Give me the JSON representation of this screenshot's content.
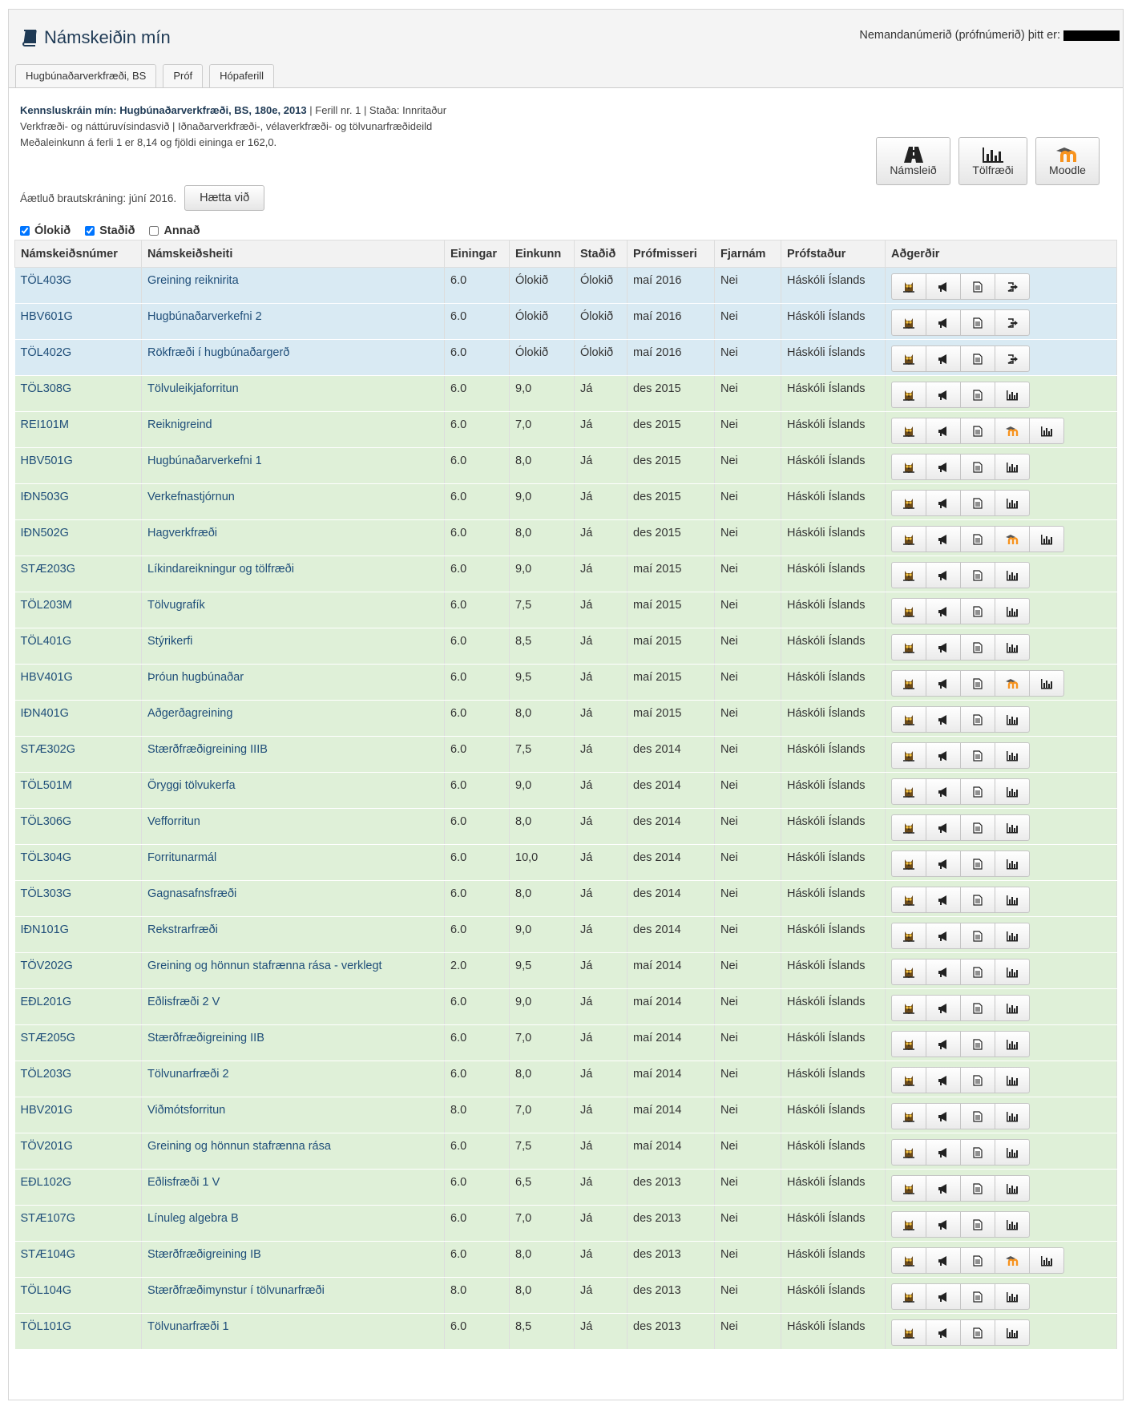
{
  "header": {
    "title": "Námskeiðin mín",
    "student_label": "Nemandanúmerið (prófnúmerið) þitt er:"
  },
  "tabs": [
    "Hugbúnaðarverkfræði, BS",
    "Próf",
    "Hópaferill"
  ],
  "info": {
    "line1_label": "Kennsluskráin mín:",
    "line1_program": "Hugbúnaðarverkfræði, BS, 180e, 2013",
    "line1_rest": "| Ferill nr. 1 | Staða: Innritaður",
    "line2": "Verkfræði- og náttúruvísindasvið | Iðnaðarverkfræði-, vélaverkfræði- og tölvunarfræðideild",
    "line3": "Meðaleinkunn á ferli 1 er 8,14 og fjöldi eininga er 162,0."
  },
  "graduation": {
    "text": "Áætluð brautskráning: júní 2016.",
    "cancel_label": "Hætta við"
  },
  "big_buttons": [
    {
      "label": "Námsleið",
      "icon": "road-icon"
    },
    {
      "label": "Tölfræði",
      "icon": "bar-chart-icon"
    },
    {
      "label": "Moodle",
      "icon": "moodle-icon"
    }
  ],
  "filters": [
    {
      "label": "Ólokið",
      "checked": true
    },
    {
      "label": "Staðið",
      "checked": true
    },
    {
      "label": "Annað",
      "checked": false
    }
  ],
  "columns": [
    "Námskeiðsnúmer",
    "Námskeiðsheiti",
    "Einingar",
    "Einkunn",
    "Staðið",
    "Prófmisseri",
    "Fjarnám",
    "Prófstaður",
    "Aðgerðir"
  ],
  "rows": [
    {
      "code": "TÖL403G",
      "name": "Greining reiknirita",
      "units": "6.0",
      "grade": "Ólokið",
      "passed": "Ólokið",
      "term": "maí 2016",
      "remote": "Nei",
      "place": "Háskóli Íslands",
      "type": "open",
      "actions": [
        "ugla-icon",
        "megaphone-icon",
        "document-icon",
        "exit-icon"
      ]
    },
    {
      "code": "HBV601G",
      "name": "Hugbúnaðarverkefni 2",
      "units": "6.0",
      "grade": "Ólokið",
      "passed": "Ólokið",
      "term": "maí 2016",
      "remote": "Nei",
      "place": "Háskóli Íslands",
      "type": "open",
      "actions": [
        "ugla-icon",
        "megaphone-icon",
        "document-icon",
        "exit-icon"
      ]
    },
    {
      "code": "TÖL402G",
      "name": "Rökfræði í hugbúnaðargerð",
      "units": "6.0",
      "grade": "Ólokið",
      "passed": "Ólokið",
      "term": "maí 2016",
      "remote": "Nei",
      "place": "Háskóli Íslands",
      "type": "open",
      "actions": [
        "ugla-icon",
        "megaphone-icon",
        "document-icon",
        "exit-icon"
      ]
    },
    {
      "code": "TÖL308G",
      "name": "Tölvuleikjaforritun",
      "units": "6.0",
      "grade": "9,0",
      "passed": "Já",
      "term": "des 2015",
      "remote": "Nei",
      "place": "Háskóli Íslands",
      "type": "done",
      "actions": [
        "ugla-icon",
        "megaphone-icon",
        "document-icon",
        "bar-chart-icon"
      ]
    },
    {
      "code": "REI101M",
      "name": "Reiknigreind",
      "units": "6.0",
      "grade": "7,0",
      "passed": "Já",
      "term": "des 2015",
      "remote": "Nei",
      "place": "Háskóli Íslands",
      "type": "done",
      "actions": [
        "ugla-icon",
        "megaphone-icon",
        "document-icon",
        "moodle-icon",
        "bar-chart-icon"
      ]
    },
    {
      "code": "HBV501G",
      "name": "Hugbúnaðarverkefni 1",
      "units": "6.0",
      "grade": "8,0",
      "passed": "Já",
      "term": "des 2015",
      "remote": "Nei",
      "place": "Háskóli Íslands",
      "type": "done",
      "actions": [
        "ugla-icon",
        "megaphone-icon",
        "document-icon",
        "bar-chart-icon"
      ]
    },
    {
      "code": "IÐN503G",
      "name": "Verkefnastjórnun",
      "units": "6.0",
      "grade": "9,0",
      "passed": "Já",
      "term": "des 2015",
      "remote": "Nei",
      "place": "Háskóli Íslands",
      "type": "done",
      "actions": [
        "ugla-icon",
        "megaphone-icon",
        "document-icon",
        "bar-chart-icon"
      ]
    },
    {
      "code": "IÐN502G",
      "name": "Hagverkfræði",
      "units": "6.0",
      "grade": "8,0",
      "passed": "Já",
      "term": "des 2015",
      "remote": "Nei",
      "place": "Háskóli Íslands",
      "type": "done",
      "actions": [
        "ugla-icon",
        "megaphone-icon",
        "document-icon",
        "moodle-icon",
        "bar-chart-icon"
      ]
    },
    {
      "code": "STÆ203G",
      "name": "Líkindareikningur og tölfræði",
      "units": "6.0",
      "grade": "9,0",
      "passed": "Já",
      "term": "maí 2015",
      "remote": "Nei",
      "place": "Háskóli Íslands",
      "type": "done",
      "actions": [
        "ugla-icon",
        "megaphone-icon",
        "document-icon",
        "bar-chart-icon"
      ]
    },
    {
      "code": "TÖL203M",
      "name": "Tölvugrafík",
      "units": "6.0",
      "grade": "7,5",
      "passed": "Já",
      "term": "maí 2015",
      "remote": "Nei",
      "place": "Háskóli Íslands",
      "type": "done",
      "actions": [
        "ugla-icon",
        "megaphone-icon",
        "document-icon",
        "bar-chart-icon"
      ]
    },
    {
      "code": "TÖL401G",
      "name": "Stýrikerfi",
      "units": "6.0",
      "grade": "8,5",
      "passed": "Já",
      "term": "maí 2015",
      "remote": "Nei",
      "place": "Háskóli Íslands",
      "type": "done",
      "actions": [
        "ugla-icon",
        "megaphone-icon",
        "document-icon",
        "bar-chart-icon"
      ]
    },
    {
      "code": "HBV401G",
      "name": "Þróun hugbúnaðar",
      "units": "6.0",
      "grade": "9,5",
      "passed": "Já",
      "term": "maí 2015",
      "remote": "Nei",
      "place": "Háskóli Íslands",
      "type": "done",
      "actions": [
        "ugla-icon",
        "megaphone-icon",
        "document-icon",
        "moodle-icon",
        "bar-chart-icon"
      ]
    },
    {
      "code": "IÐN401G",
      "name": "Aðgerðagreining",
      "units": "6.0",
      "grade": "8,0",
      "passed": "Já",
      "term": "maí 2015",
      "remote": "Nei",
      "place": "Háskóli Íslands",
      "type": "done",
      "actions": [
        "ugla-icon",
        "megaphone-icon",
        "document-icon",
        "bar-chart-icon"
      ]
    },
    {
      "code": "STÆ302G",
      "name": "Stærðfræðigreining IIIB",
      "units": "6.0",
      "grade": "7,5",
      "passed": "Já",
      "term": "des 2014",
      "remote": "Nei",
      "place": "Háskóli Íslands",
      "type": "done",
      "actions": [
        "ugla-icon",
        "megaphone-icon",
        "document-icon",
        "bar-chart-icon"
      ]
    },
    {
      "code": "TÖL501M",
      "name": "Öryggi tölvukerfa",
      "units": "6.0",
      "grade": "9,0",
      "passed": "Já",
      "term": "des 2014",
      "remote": "Nei",
      "place": "Háskóli Íslands",
      "type": "done",
      "actions": [
        "ugla-icon",
        "megaphone-icon",
        "document-icon",
        "bar-chart-icon"
      ]
    },
    {
      "code": "TÖL306G",
      "name": "Vefforritun",
      "units": "6.0",
      "grade": "8,0",
      "passed": "Já",
      "term": "des 2014",
      "remote": "Nei",
      "place": "Háskóli Íslands",
      "type": "done",
      "actions": [
        "ugla-icon",
        "megaphone-icon",
        "document-icon",
        "bar-chart-icon"
      ]
    },
    {
      "code": "TÖL304G",
      "name": "Forritunarmál",
      "units": "6.0",
      "grade": "10,0",
      "passed": "Já",
      "term": "des 2014",
      "remote": "Nei",
      "place": "Háskóli Íslands",
      "type": "done",
      "actions": [
        "ugla-icon",
        "megaphone-icon",
        "document-icon",
        "bar-chart-icon"
      ]
    },
    {
      "code": "TÖL303G",
      "name": "Gagnasafnsfræði",
      "units": "6.0",
      "grade": "8,0",
      "passed": "Já",
      "term": "des 2014",
      "remote": "Nei",
      "place": "Háskóli Íslands",
      "type": "done",
      "actions": [
        "ugla-icon",
        "megaphone-icon",
        "document-icon",
        "bar-chart-icon"
      ]
    },
    {
      "code": "IÐN101G",
      "name": "Rekstrarfræði",
      "units": "6.0",
      "grade": "9,0",
      "passed": "Já",
      "term": "des 2014",
      "remote": "Nei",
      "place": "Háskóli Íslands",
      "type": "done",
      "actions": [
        "ugla-icon",
        "megaphone-icon",
        "document-icon",
        "bar-chart-icon"
      ]
    },
    {
      "code": "TÖV202G",
      "name": "Greining og hönnun stafrænna rása - verklegt",
      "units": "2.0",
      "grade": "9,5",
      "passed": "Já",
      "term": "maí 2014",
      "remote": "Nei",
      "place": "Háskóli Íslands",
      "type": "done",
      "actions": [
        "ugla-icon",
        "megaphone-icon",
        "document-icon",
        "bar-chart-icon"
      ]
    },
    {
      "code": "EÐL201G",
      "name": "Eðlisfræði 2 V",
      "units": "6.0",
      "grade": "9,0",
      "passed": "Já",
      "term": "maí 2014",
      "remote": "Nei",
      "place": "Háskóli Íslands",
      "type": "done",
      "actions": [
        "ugla-icon",
        "megaphone-icon",
        "document-icon",
        "bar-chart-icon"
      ]
    },
    {
      "code": "STÆ205G",
      "name": "Stærðfræðigreining IIB",
      "units": "6.0",
      "grade": "7,0",
      "passed": "Já",
      "term": "maí 2014",
      "remote": "Nei",
      "place": "Háskóli Íslands",
      "type": "done",
      "actions": [
        "ugla-icon",
        "megaphone-icon",
        "document-icon",
        "bar-chart-icon"
      ]
    },
    {
      "code": "TÖL203G",
      "name": "Tölvunarfræði 2",
      "units": "6.0",
      "grade": "8,0",
      "passed": "Já",
      "term": "maí 2014",
      "remote": "Nei",
      "place": "Háskóli Íslands",
      "type": "done",
      "actions": [
        "ugla-icon",
        "megaphone-icon",
        "document-icon",
        "bar-chart-icon"
      ]
    },
    {
      "code": "HBV201G",
      "name": "Viðmótsforritun",
      "units": "8.0",
      "grade": "7,0",
      "passed": "Já",
      "term": "maí 2014",
      "remote": "Nei",
      "place": "Háskóli Íslands",
      "type": "done",
      "actions": [
        "ugla-icon",
        "megaphone-icon",
        "document-icon",
        "bar-chart-icon"
      ]
    },
    {
      "code": "TÖV201G",
      "name": "Greining og hönnun stafrænna rása",
      "units": "6.0",
      "grade": "7,5",
      "passed": "Já",
      "term": "maí 2014",
      "remote": "Nei",
      "place": "Háskóli Íslands",
      "type": "done",
      "actions": [
        "ugla-icon",
        "megaphone-icon",
        "document-icon",
        "bar-chart-icon"
      ]
    },
    {
      "code": "EÐL102G",
      "name": "Eðlisfræði 1 V",
      "units": "6.0",
      "grade": "6,5",
      "passed": "Já",
      "term": "des 2013",
      "remote": "Nei",
      "place": "Háskóli Íslands",
      "type": "done",
      "actions": [
        "ugla-icon",
        "megaphone-icon",
        "document-icon",
        "bar-chart-icon"
      ]
    },
    {
      "code": "STÆ107G",
      "name": "Línuleg algebra B",
      "units": "6.0",
      "grade": "7,0",
      "passed": "Já",
      "term": "des 2013",
      "remote": "Nei",
      "place": "Háskóli Íslands",
      "type": "done",
      "actions": [
        "ugla-icon",
        "megaphone-icon",
        "document-icon",
        "bar-chart-icon"
      ]
    },
    {
      "code": "STÆ104G",
      "name": "Stærðfræðigreining IB",
      "units": "6.0",
      "grade": "8,0",
      "passed": "Já",
      "term": "des 2013",
      "remote": "Nei",
      "place": "Háskóli Íslands",
      "type": "done",
      "actions": [
        "ugla-icon",
        "megaphone-icon",
        "document-icon",
        "moodle-icon",
        "bar-chart-icon"
      ]
    },
    {
      "code": "TÖL104G",
      "name": "Stærðfræðimynstur í tölvunarfræði",
      "units": "8.0",
      "grade": "8,0",
      "passed": "Já",
      "term": "des 2013",
      "remote": "Nei",
      "place": "Háskóli Íslands",
      "type": "done",
      "actions": [
        "ugla-icon",
        "megaphone-icon",
        "document-icon",
        "bar-chart-icon"
      ]
    },
    {
      "code": "TÖL101G",
      "name": "Tölvunarfræði 1",
      "units": "6.0",
      "grade": "8,5",
      "passed": "Já",
      "term": "des 2013",
      "remote": "Nei",
      "place": "Háskóli Íslands",
      "type": "done",
      "actions": [
        "ugla-icon",
        "megaphone-icon",
        "document-icon",
        "bar-chart-icon"
      ]
    }
  ]
}
